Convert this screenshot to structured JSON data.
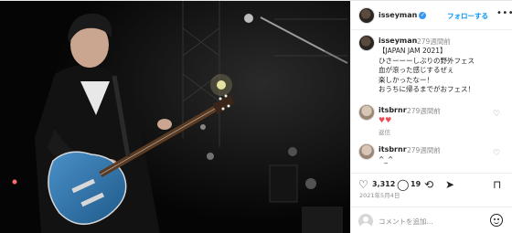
{
  "post": {
    "photo_alt": "",
    "author": {
      "username": "isseyman",
      "verified": true
    },
    "follow_label": "フォローする",
    "more_label": "•••",
    "caption": {
      "username": "isseyman",
      "time": "279週間前",
      "text": "【JAPAN JAM 2021】\nひさーーーしぶりの野外フェス\n血が滾った感じするぜぇ\n楽しかったなー！\nおうちに帰るまでがおフェス！"
    },
    "comments": [
      {
        "username": "itsbrnr",
        "time": "279週間前",
        "text": "♥♥",
        "reply_label": "返信"
      },
      {
        "username": "itsbrnr",
        "time": "279週間前",
        "text": "^_^",
        "reply_label": ""
      }
    ],
    "likes_count": "3,312",
    "comments_count": "19",
    "date": "2021年5月4日",
    "composer": {
      "placeholder": "コメントを追加..."
    }
  },
  "colors": {
    "link": "#0095f6",
    "verified": "#3897f0",
    "muted": "#8e8e8e",
    "heart": "#ed4956"
  },
  "icons": [
    "heart-icon",
    "comment-icon",
    "share-icon",
    "send-icon",
    "bookmark-icon",
    "emoji-icon",
    "more-icon",
    "verified-icon"
  ]
}
